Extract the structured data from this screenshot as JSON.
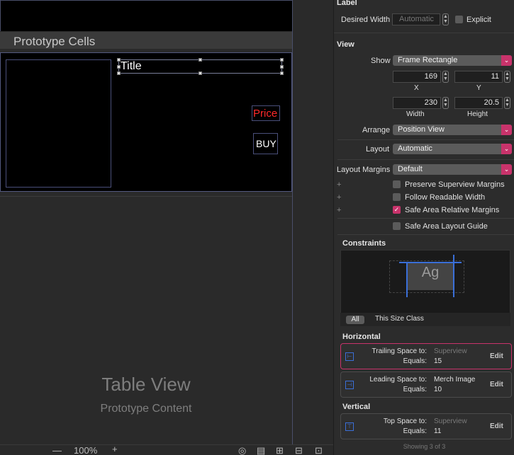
{
  "canvas": {
    "section_header": "Prototype Cells",
    "title_label": "Title",
    "price_label": "Price",
    "buy_button": "BUY",
    "table_view_title": "Table View",
    "table_view_subtitle": "Prototype Content",
    "zoom": "100%",
    "zoom_out": "—",
    "zoom_in": "+"
  },
  "inspector": {
    "label_section": {
      "title": "Label",
      "desired_width_label": "Desired Width",
      "desired_width_value": "Automatic",
      "explicit_label": "Explicit"
    },
    "view_section": {
      "title": "View",
      "show_label": "Show",
      "show_value": "Frame Rectangle",
      "x_value": "169",
      "y_value": "11",
      "x_label": "X",
      "y_label": "Y",
      "width_value": "230",
      "height_value": "20.5",
      "width_label": "Width",
      "height_label": "Height",
      "arrange_label": "Arrange",
      "arrange_value": "Position View",
      "layout_label": "Layout",
      "layout_value": "Automatic",
      "margins_label": "Layout Margins",
      "margins_value": "Default",
      "preserve_label": "Preserve Superview Margins",
      "follow_label": "Follow Readable Width",
      "safe_rel_label": "Safe Area Relative Margins",
      "safe_guide_label": "Safe Area Layout Guide"
    },
    "constraints": {
      "title": "Constraints",
      "preview_text": "Ag",
      "all_tab": "All",
      "size_class": "This Size Class",
      "horizontal_title": "Horizontal",
      "vertical_title": "Vertical",
      "trailing_to_label": "Trailing Space to:",
      "trailing_to_value": "Superview",
      "trailing_equals_label": "Equals:",
      "trailing_equals_value": "15",
      "leading_to_label": "Leading Space to:",
      "leading_to_value": "Merch Image",
      "leading_equals_label": "Equals:",
      "leading_equals_value": "10",
      "top_to_label": "Top Space to:",
      "top_to_value": "Superview",
      "top_equals_label": "Equals:",
      "top_equals_value": "11",
      "edit_label": "Edit",
      "showing": "Showing 3 of 3"
    }
  },
  "colors": {
    "accent": "#c8336b",
    "price": "#ff2a2a",
    "constraint_blue": "#3a6fd8"
  }
}
